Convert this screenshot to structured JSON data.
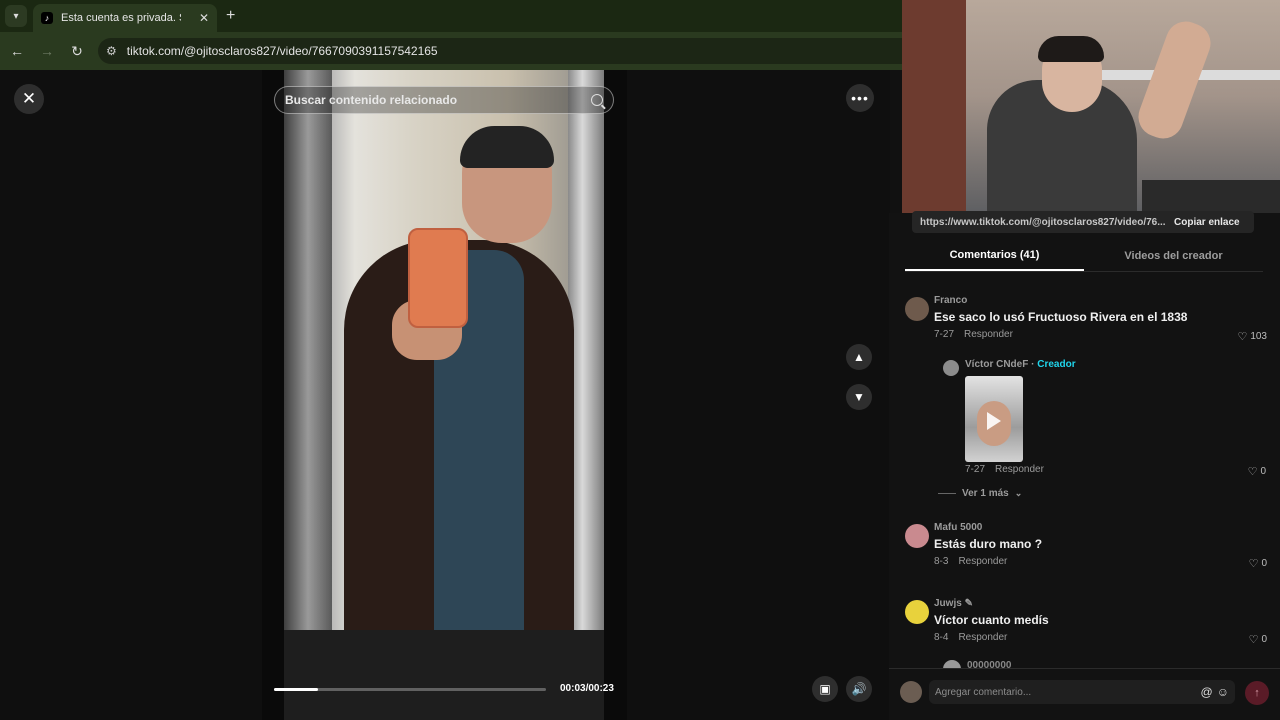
{
  "browser": {
    "tab_title": "Esta cuenta es privada. Sigue",
    "url": "tiktok.com/@ojitosclaros827/video/7667090391157542165",
    "favicon": "tiktok-icon"
  },
  "video": {
    "search_placeholder": "Buscar contenido relacionado",
    "time": "00:03/00:23",
    "progress_fraction": 0.16
  },
  "share": {
    "link": "https://www.tiktok.com/@ojitosclaros827/video/76...",
    "copy_label": "Copiar enlace"
  },
  "tabs": {
    "comments": "Comentarios (41)",
    "creator_videos": "Videos del creador"
  },
  "comments": [
    {
      "user": "Franco",
      "text": "Ese saco lo usó Fructuoso Rivera en el 1838",
      "date": "7-27",
      "reply": "Responder",
      "likes": "103"
    },
    {
      "user": "Mafu 5000",
      "text": "Estás duro mano ?",
      "date": "8-3",
      "reply": "Responder",
      "likes": "0"
    },
    {
      "user": "Juwjs",
      "text": "Víctor cuanto medís",
      "date": "8-4",
      "reply": "Responder",
      "likes": "0"
    }
  ],
  "creator_reply": {
    "user": "Víctor CNdeF",
    "creator_label": "Creador",
    "date": "7-27",
    "reply": "Responder",
    "likes": "0"
  },
  "view_more": "Ver 1 más",
  "partial_comment": "00000000",
  "composer": {
    "placeholder": "Agregar comentario...",
    "mention": "@",
    "emoji": "☺"
  },
  "colors": {
    "accent_creator": "#20d5ec",
    "browser_bg": "#1b2812",
    "panel_bg": "#121212"
  }
}
